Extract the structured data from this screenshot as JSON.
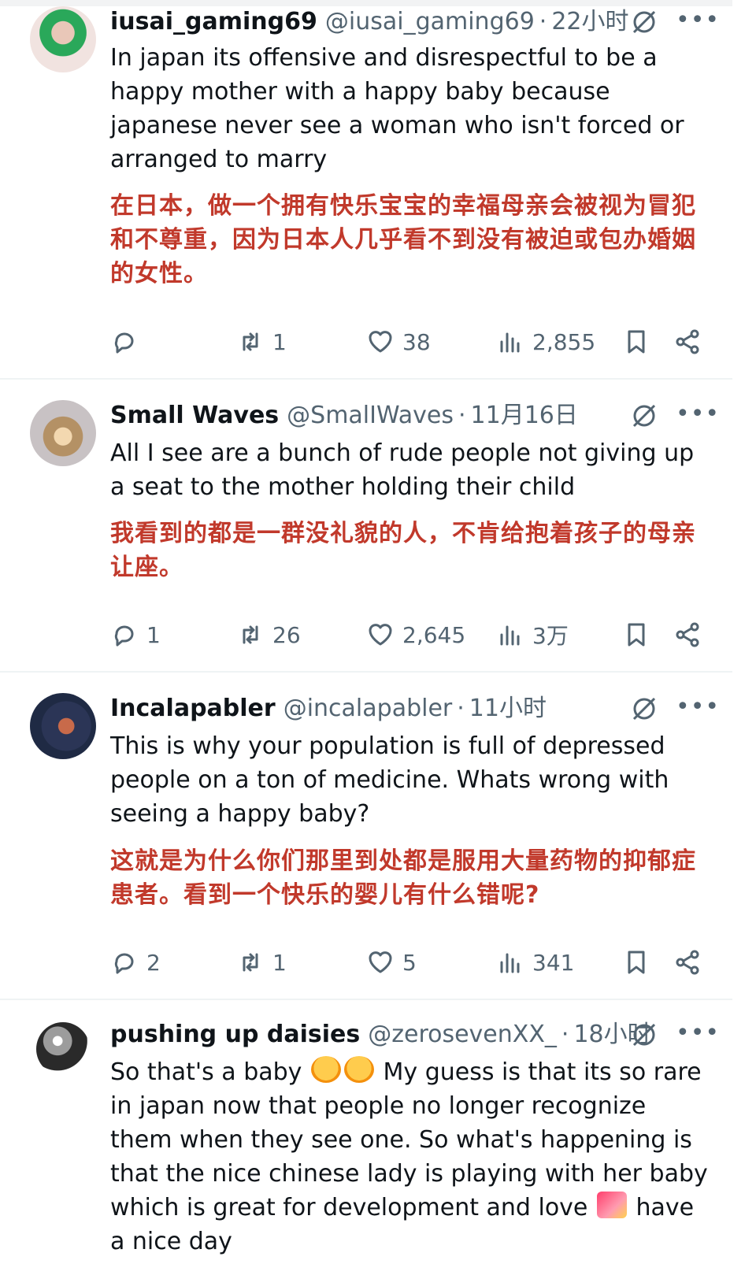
{
  "posts": [
    {
      "user": "iusai_gaming69",
      "handle": "@iusai_gaming69",
      "time": "22小时",
      "text_en": "In japan its offensive and disrespectful to be a happy mother with a happy baby because japanese never see a woman who isn't forced or arranged to marry",
      "text_zh": "在日本，做一个拥有快乐宝宝的幸福母亲会被视为冒犯和不尊重，因为日本人几乎看不到没有被迫或包办婚姻的女性。",
      "replies": "",
      "reposts": "1",
      "likes": "38",
      "views": "2,855"
    },
    {
      "user": "Small Waves",
      "handle": "@SmalIWaves",
      "time": "11月16日",
      "text_en": "All I see are a bunch of rude people not giving up a seat to the mother holding their child",
      "text_zh": "我看到的都是一群没礼貌的人，不肯给抱着孩子的母亲让座。",
      "replies": "1",
      "reposts": "26",
      "likes": "2,645",
      "views": "3万"
    },
    {
      "user": "Incalapabler",
      "handle": "@incalapabler",
      "time": "11小时",
      "text_en": "This is why your population is full of depressed people on a ton of medicine. Whats wrong with seeing a happy baby?",
      "text_zh": "这就是为什么你们那里到处都是服用大量药物的抑郁症患者。看到一个快乐的婴儿有什么错呢?",
      "replies": "2",
      "reposts": "1",
      "likes": "5",
      "views": "341"
    },
    {
      "user": "pushing up daisies",
      "handle": "@zerosevenXX_",
      "time": "18小时",
      "text_en_1": "So that's a baby",
      "text_en_2": "My guess is that its so rare in japan now that people no longer recognize them when they see one. So what's happening is that the nice chinese lady is playing with her baby which is great for development and love",
      "text_en_3": "have a nice day"
    }
  ],
  "icons": {
    "reply": "reply-icon",
    "repost": "repost-icon",
    "like": "heart-icon",
    "views": "views-icon",
    "bookmark": "bookmark-icon",
    "share": "share-icon",
    "grok": "grok-icon",
    "more": "more-icon"
  },
  "colors": {
    "text": "#0f1419",
    "muted": "#536471",
    "translation": "#c1392b",
    "divider": "#eff3f4"
  }
}
